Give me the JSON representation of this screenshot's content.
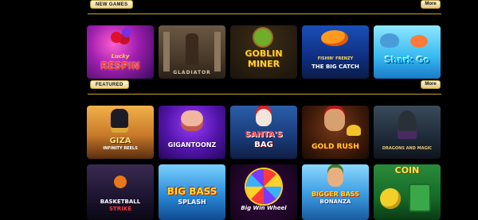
{
  "sections": {
    "new_games": {
      "label": "NEW GAMES",
      "more_label": "More"
    },
    "featured": {
      "label": "FEATURED",
      "more_label": "More"
    }
  },
  "games_row1": [
    {
      "title_line1": "Lucky",
      "title_line2": "RESPIN"
    },
    {
      "title_line1": "GLADIATOR",
      "title_line2": ""
    },
    {
      "title_line1": "GOBLIN",
      "title_line2": "MINER"
    },
    {
      "title_line1": "FISHIN' FRENZY",
      "title_line2": "THE BIG CATCH"
    },
    {
      "title_line1": "Shark Go",
      "title_line2": ""
    }
  ],
  "games_row2": [
    {
      "title_line1": "GIZA",
      "title_line2": "INFINITY REELS"
    },
    {
      "title_line1": "GIGANTOONZ",
      "title_line2": ""
    },
    {
      "title_line1": "SANTA'S",
      "title_line2": "BAG"
    },
    {
      "title_line1": "GOLD RUSH",
      "title_line2": ""
    },
    {
      "title_line1": "DRAGONS AND MAGIC",
      "title_line2": ""
    }
  ],
  "games_row3": [
    {
      "title_line1": "BASKETBALL",
      "title_line2": "STRIKE"
    },
    {
      "title_line1": "BIG BASS",
      "title_line2": "SPLASH"
    },
    {
      "title_line1": "Big Win Wheel",
      "title_line2": ""
    },
    {
      "title_line1": "BIGGER BASS",
      "title_line2": "BONANZA"
    },
    {
      "title_line1": "COIN",
      "title_line2": ""
    }
  ],
  "colors": {
    "accent_gold": "#c9a534",
    "button_gradient_top": "#fff6d6",
    "background": "#000000"
  }
}
